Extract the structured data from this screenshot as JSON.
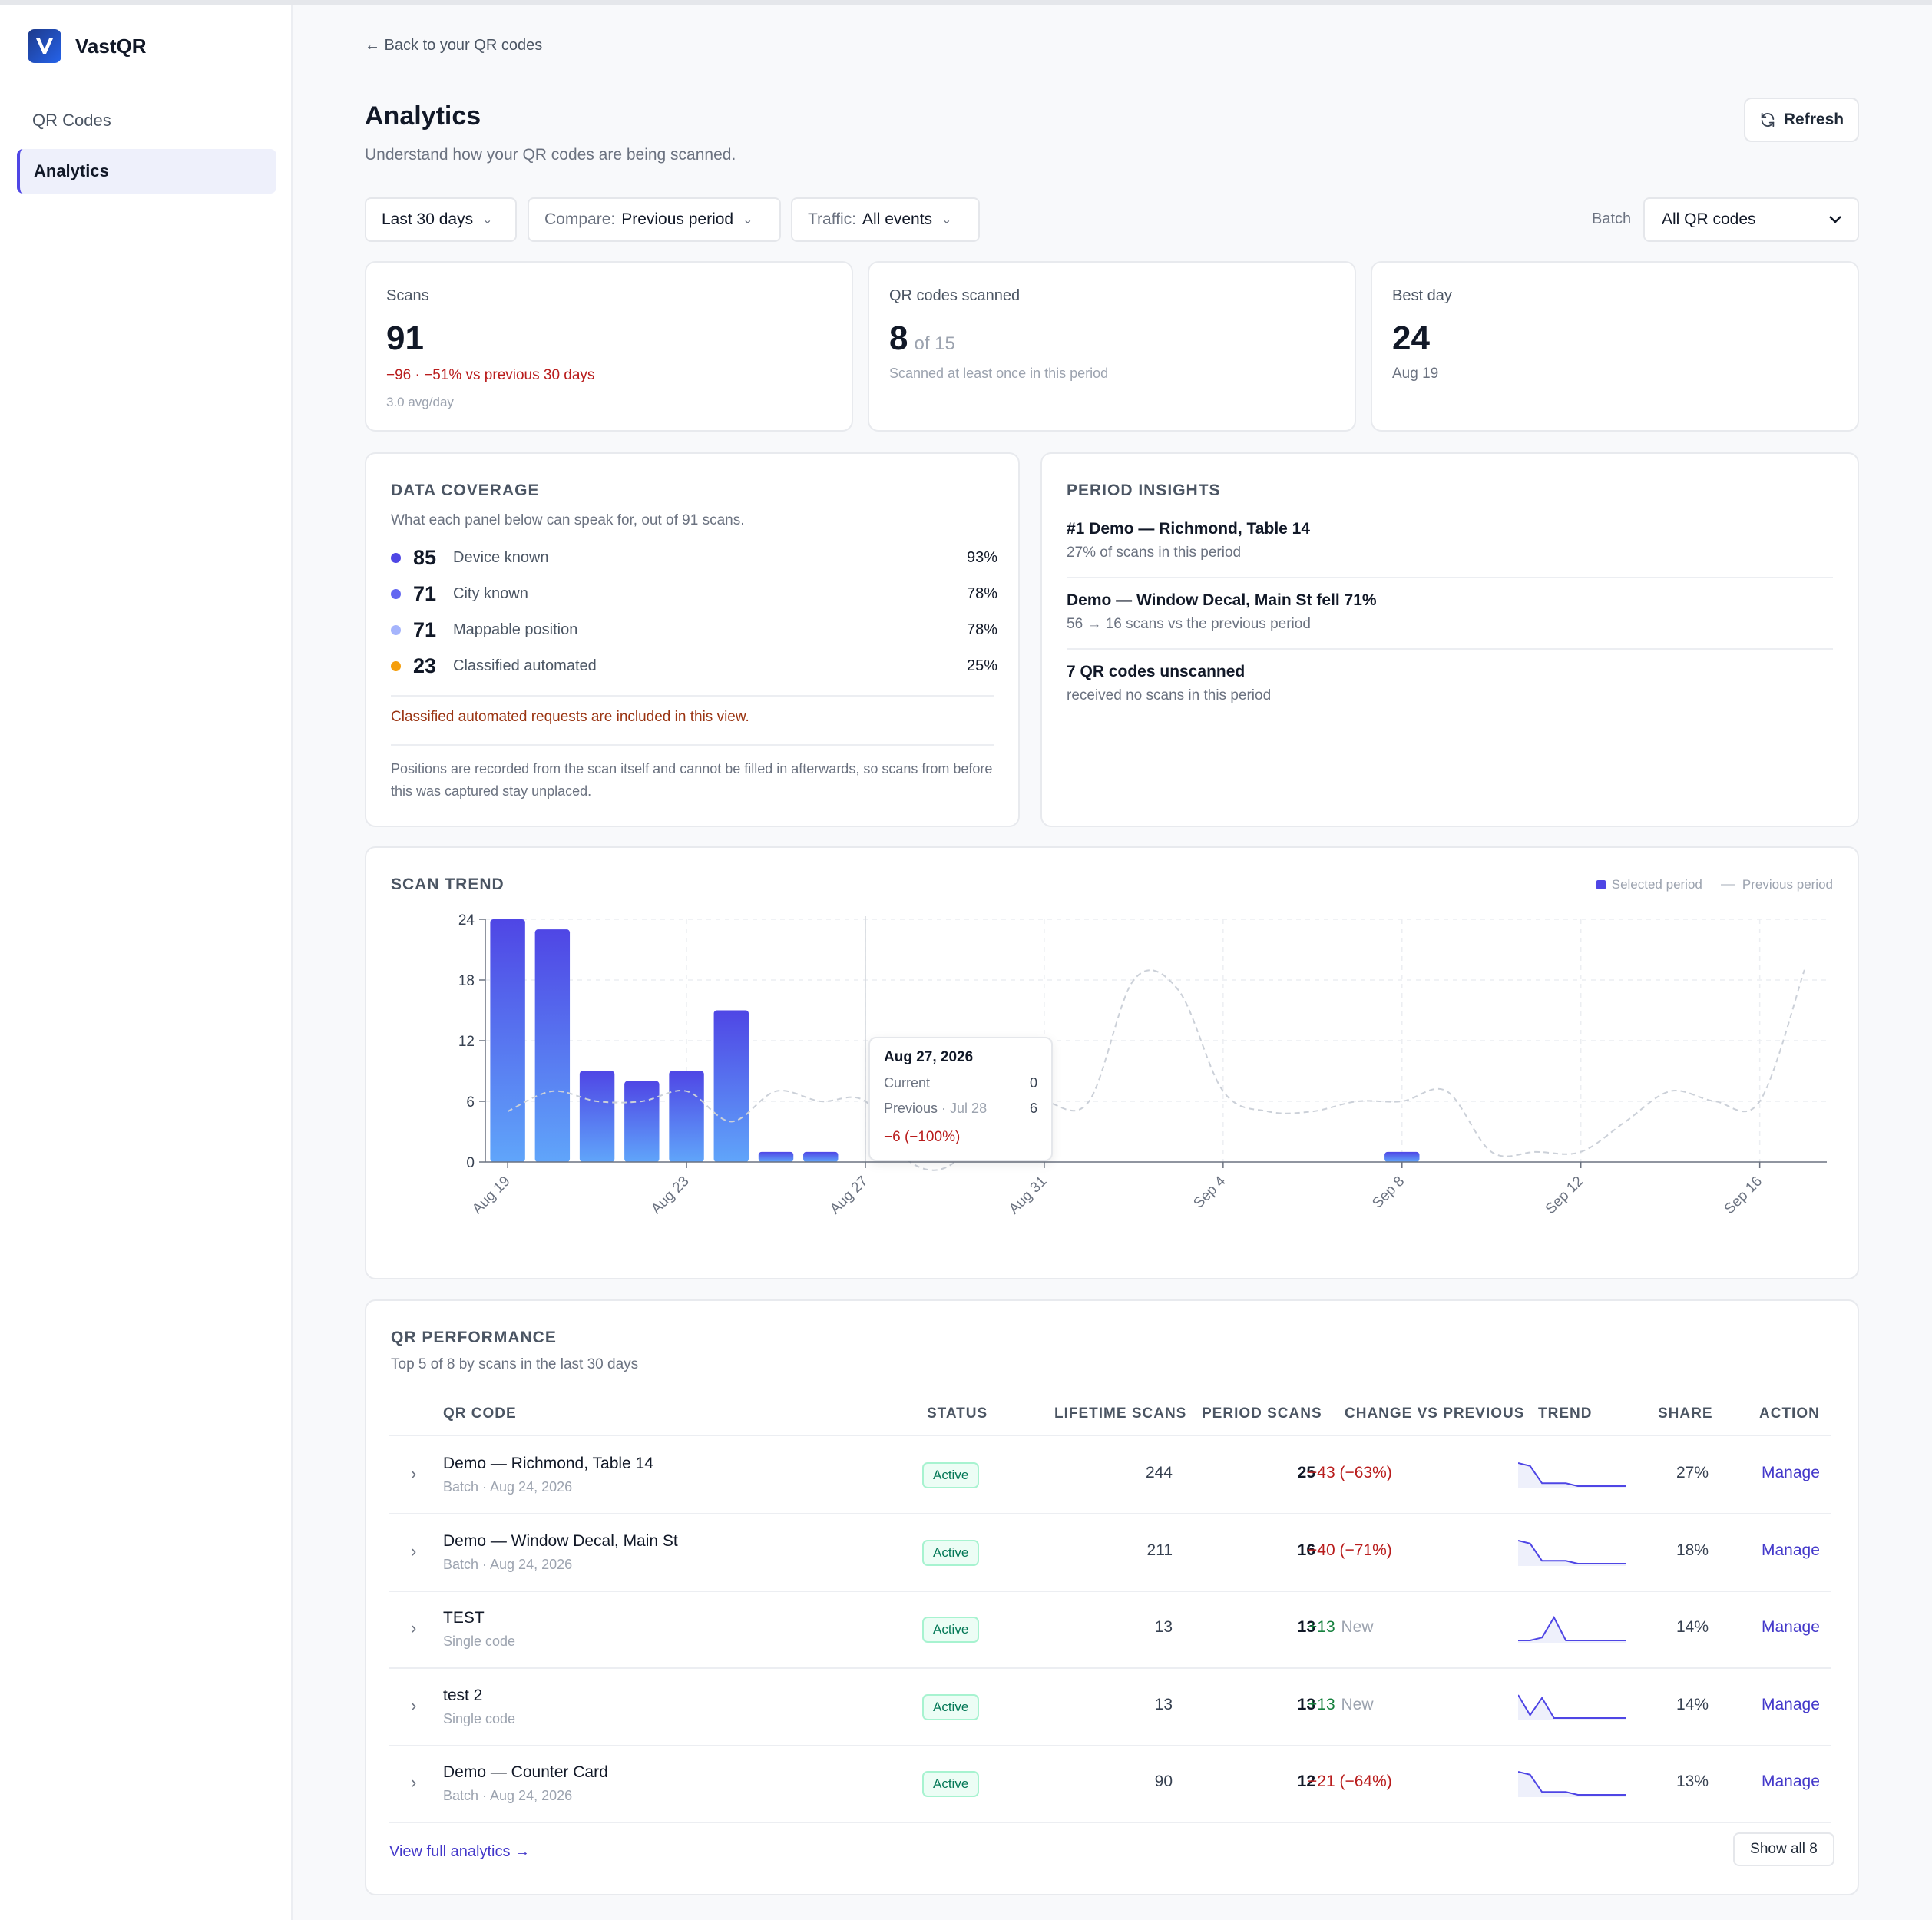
{
  "app": {
    "name": "VastQR"
  },
  "sidebar": {
    "items": [
      {
        "label": "QR Codes"
      },
      {
        "label": "Analytics"
      }
    ]
  },
  "header": {
    "back_link": "← Back to your QR codes",
    "title": "Analytics",
    "subtitle": "Understand how your QR codes are being scanned.",
    "refresh_label": "Refresh"
  },
  "filters": {
    "range": "Last 30 days",
    "compare_label": "Compare:",
    "compare_value": "Previous period",
    "traffic_label": "Traffic:",
    "traffic_value": "All events",
    "batch_label": "Batch",
    "batch_value": "All QR codes"
  },
  "kpis": {
    "scans": {
      "label": "Scans",
      "value": "91",
      "delta": "−96 · −51% vs previous 30 days",
      "avg": "3.0 avg/day"
    },
    "scanned": {
      "label": "QR codes scanned",
      "value": "8",
      "of": "of 15",
      "note": "Scanned at least once in this period"
    },
    "best": {
      "label": "Best day",
      "value": "24",
      "date": "Aug 19"
    }
  },
  "coverage": {
    "title": "DATA COVERAGE",
    "subtitle": "What each panel below can speak for, out of 91 scans.",
    "rows": [
      {
        "num": "85",
        "label": "Device known",
        "pct": "93%",
        "color": "#4f46e5"
      },
      {
        "num": "71",
        "label": "City known",
        "pct": "78%",
        "color": "#6366f1"
      },
      {
        "num": "71",
        "label": "Mappable position",
        "pct": "78%",
        "color": "#a5b4fc"
      },
      {
        "num": "23",
        "label": "Classified automated",
        "pct": "25%",
        "color": "#f59e0b"
      }
    ],
    "warning": "Classified automated requests are included in this view.",
    "footnote": "Positions are recorded from the scan itself and cannot be filled in afterwards, so scans from before this was captured stay unplaced."
  },
  "insights": {
    "title": "PERIOD INSIGHTS",
    "items": [
      {
        "title": "#1 Demo — Richmond, Table 14",
        "sub": "27% of scans in this period"
      },
      {
        "title": "Demo — Window Decal, Main St fell 71%",
        "sub": "56 → 16 scans vs the previous period"
      },
      {
        "title": "7 QR codes unscanned",
        "sub": "received no scans in this period"
      }
    ]
  },
  "trend": {
    "title": "SCAN TREND",
    "legend_selected": "Selected period",
    "legend_previous": "Previous period",
    "tooltip": {
      "date": "Aug 27, 2026",
      "current_label": "Current",
      "current_value": "0",
      "previous_label": "Previous",
      "previous_date": "· Jul 28",
      "previous_value": "6",
      "delta": "−6 (−100%)"
    }
  },
  "chart_data": {
    "type": "bar",
    "title": "SCAN TREND",
    "x": [
      "Aug 19",
      "Aug 20",
      "Aug 21",
      "Aug 22",
      "Aug 23",
      "Aug 24",
      "Aug 25",
      "Aug 26",
      "Aug 27",
      "Aug 28",
      "Aug 29",
      "Aug 30",
      "Aug 31",
      "Sep 1",
      "Sep 2",
      "Sep 3",
      "Sep 4",
      "Sep 5",
      "Sep 6",
      "Sep 7",
      "Sep 8",
      "Sep 9",
      "Sep 10",
      "Sep 11",
      "Sep 12",
      "Sep 13",
      "Sep 14",
      "Sep 15",
      "Sep 16",
      "Sep 17"
    ],
    "x_ticks": [
      "Aug 19",
      "Aug 23",
      "Aug 27",
      "Aug 31",
      "Sep 4",
      "Sep 8",
      "Sep 12",
      "Sep 16"
    ],
    "ylim": [
      0,
      24
    ],
    "y_ticks": [
      0,
      6,
      12,
      18,
      24
    ],
    "grid": true,
    "legend": "top-right",
    "series": [
      {
        "name": "Selected period",
        "type": "bar",
        "values": [
          24,
          23,
          9,
          8,
          9,
          15,
          1,
          1,
          0,
          0,
          0,
          0,
          0,
          0,
          0,
          0,
          0,
          0,
          0,
          0,
          1,
          0,
          0,
          0,
          0,
          0,
          0,
          0,
          0,
          0
        ]
      },
      {
        "name": "Previous period",
        "type": "line",
        "values": [
          5,
          7,
          6,
          6,
          7,
          4,
          7,
          6,
          6,
          0,
          0,
          7,
          6,
          6,
          18,
          17,
          7,
          5,
          5,
          6,
          6,
          7,
          1,
          1,
          1,
          4,
          7,
          6,
          6,
          19
        ]
      }
    ]
  },
  "performance": {
    "title": "QR PERFORMANCE",
    "subtitle": "Top 5 of 8 by scans in the last 30 days",
    "columns": [
      "QR CODE",
      "STATUS",
      "LIFETIME SCANS",
      "PERIOD SCANS",
      "CHANGE VS PREVIOUS",
      "TREND",
      "SHARE",
      "ACTION"
    ],
    "rows": [
      {
        "name": "Demo — Richmond, Table 14",
        "meta": "Batch · Aug 24, 2026",
        "status": "Active",
        "lifetime": "244",
        "period": "25",
        "change": "−43 (−63%)",
        "change_new": "",
        "share": "27%",
        "action": "Manage",
        "sign": "neg",
        "spark": [
          8,
          7,
          1,
          1,
          1,
          0,
          0,
          0,
          0,
          0
        ]
      },
      {
        "name": "Demo — Window Decal, Main St",
        "meta": "Batch · Aug 24, 2026",
        "status": "Active",
        "lifetime": "211",
        "period": "16",
        "change": "−40 (−71%)",
        "change_new": "",
        "share": "18%",
        "action": "Manage",
        "sign": "neg",
        "spark": [
          8,
          7,
          1,
          1,
          1,
          0,
          0,
          0,
          0,
          0
        ]
      },
      {
        "name": "TEST",
        "meta": "Single code",
        "status": "Active",
        "lifetime": "13",
        "period": "13",
        "change": "+13",
        "change_new": "New",
        "share": "14%",
        "action": "Manage",
        "sign": "pos",
        "spark": [
          0,
          0,
          1,
          8,
          0,
          0,
          0,
          0,
          0,
          0
        ]
      },
      {
        "name": "test 2",
        "meta": "Single code",
        "status": "Active",
        "lifetime": "13",
        "period": "13",
        "change": "+13",
        "change_new": "New",
        "share": "14%",
        "action": "Manage",
        "sign": "pos",
        "spark": [
          8,
          1,
          7,
          0,
          0,
          0,
          0,
          0,
          0,
          0
        ]
      },
      {
        "name": "Demo — Counter Card",
        "meta": "Batch · Aug 24, 2026",
        "status": "Active",
        "lifetime": "90",
        "period": "12",
        "change": "−21 (−64%)",
        "change_new": "",
        "share": "13%",
        "action": "Manage",
        "sign": "neg",
        "spark": [
          8,
          7,
          1,
          1,
          1,
          0,
          0,
          0,
          0,
          0
        ]
      }
    ],
    "view_full": "View full analytics →",
    "show_all": "Show all 8"
  }
}
